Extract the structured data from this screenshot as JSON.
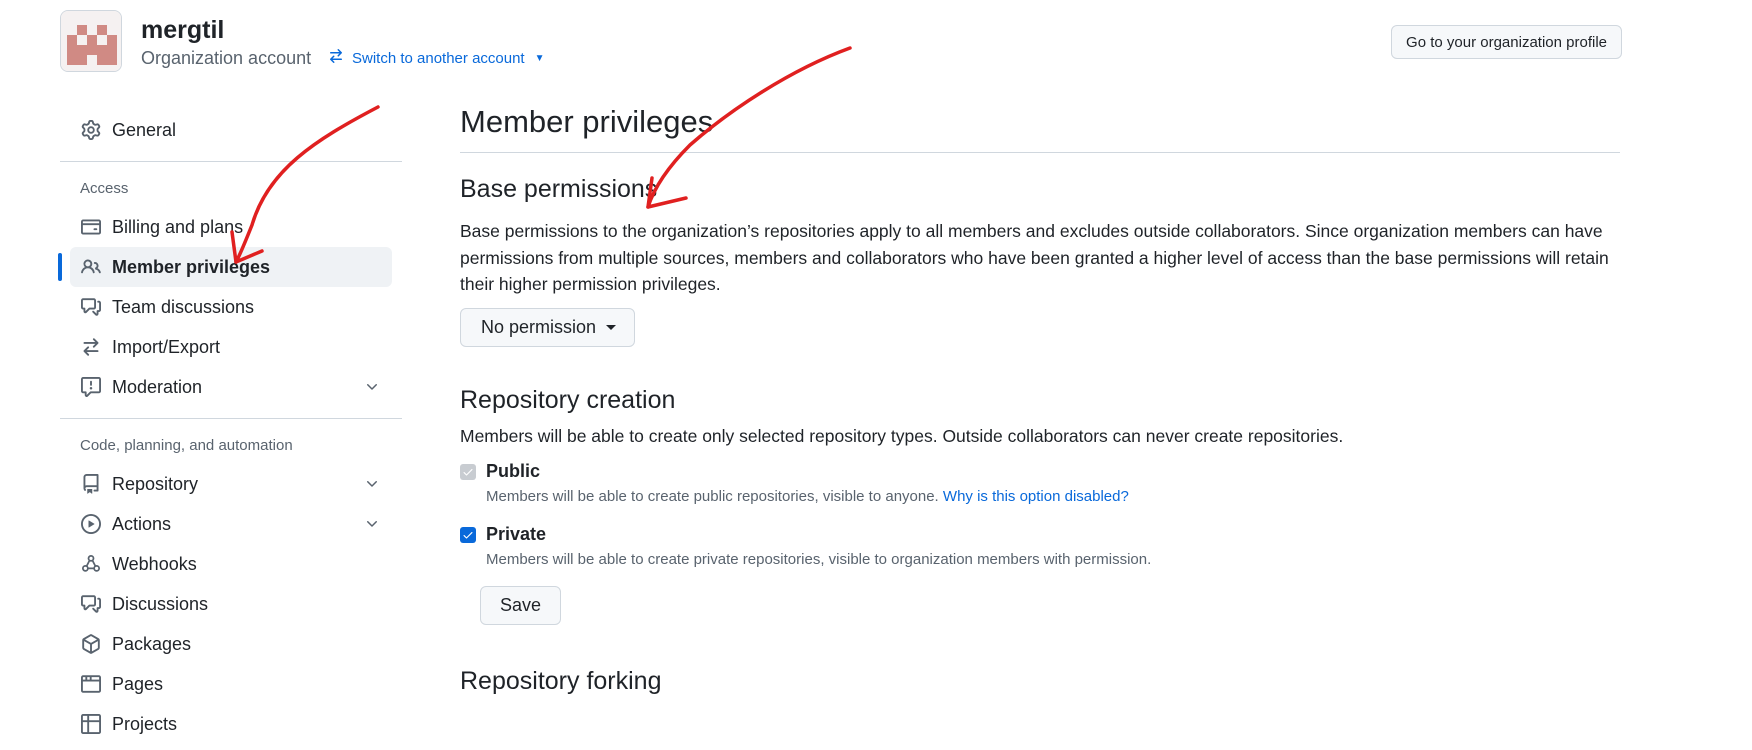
{
  "org": {
    "name": "mergtil",
    "type": "Organization account",
    "switch_label": "Switch to another account",
    "profile_button": "Go to your organization profile"
  },
  "sidebar": {
    "general": "General",
    "access_heading": "Access",
    "access_items": [
      {
        "label": "Billing and plans",
        "icon": "credit-card-icon"
      },
      {
        "label": "Member privileges",
        "icon": "people-icon",
        "active": true
      },
      {
        "label": "Team discussions",
        "icon": "comment-discussion-icon"
      },
      {
        "label": "Import/Export",
        "icon": "arrow-switch-icon"
      },
      {
        "label": "Moderation",
        "icon": "report-icon",
        "expandable": true
      }
    ],
    "code_heading": "Code, planning, and automation",
    "code_items": [
      {
        "label": "Repository",
        "icon": "repo-icon",
        "expandable": true
      },
      {
        "label": "Actions",
        "icon": "play-icon",
        "expandable": true
      },
      {
        "label": "Webhooks",
        "icon": "webhook-icon"
      },
      {
        "label": "Discussions",
        "icon": "comment-discussion-icon"
      },
      {
        "label": "Packages",
        "icon": "package-icon"
      },
      {
        "label": "Pages",
        "icon": "browser-icon"
      },
      {
        "label": "Projects",
        "icon": "table-icon"
      }
    ]
  },
  "main": {
    "title": "Member privileges",
    "base_permissions": {
      "title": "Base permissions",
      "description": "Base permissions to the organization’s repositories apply to all members and excludes outside collaborators. Since organization members can have permissions from multiple sources, members and collaborators who have been granted a higher level of access than the base permissions will retain their higher permission privileges.",
      "selected": "No permission"
    },
    "repository_creation": {
      "title": "Repository creation",
      "description": "Members will be able to create only selected repository types. Outside collaborators can never create repositories.",
      "public_label": "Public",
      "public_desc": "Members will be able to create public repositories, visible to anyone.",
      "public_link": "Why is this option disabled?",
      "private_label": "Private",
      "private_desc": "Members will be able to create private repositories, visible to organization members with permission.",
      "save": "Save"
    },
    "repository_forking": {
      "title": "Repository forking"
    }
  },
  "colors": {
    "accent": "#0969da",
    "annotation": "#e02020",
    "border": "#d0d7de",
    "muted": "#59636e"
  }
}
